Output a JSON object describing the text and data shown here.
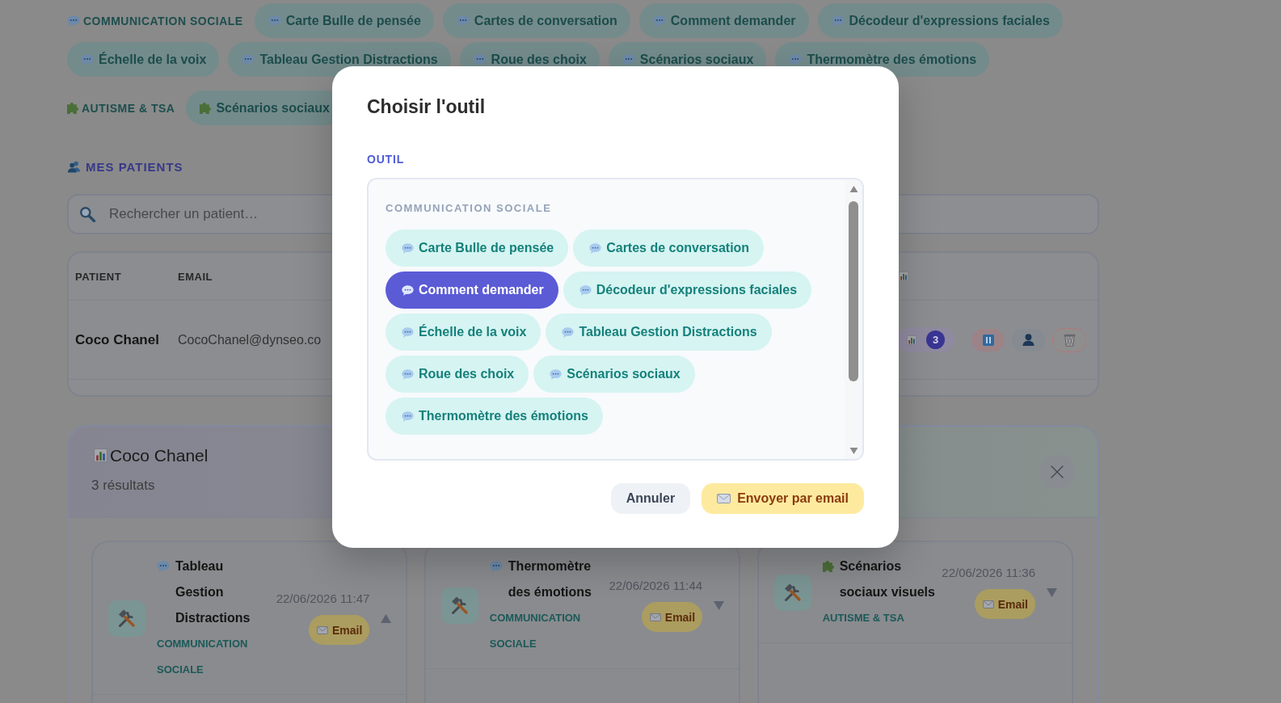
{
  "tool_groups": [
    {
      "label": "COMMUNICATION SOCIALE",
      "kind": "speech",
      "tools": [
        "Carte Bulle de pensée",
        "Cartes de conversation",
        "Comment demander",
        "Décodeur d'expressions faciales",
        "Échelle de la voix",
        "Tableau Gestion Distractions",
        "Roue des choix",
        "Scénarios sociaux",
        "Thermomètre des émotions"
      ]
    },
    {
      "label": "AUTISME & TSA",
      "kind": "puzzle",
      "tools": [
        "Scénarios sociaux"
      ]
    }
  ],
  "patients": {
    "title": "MES PATIENTS",
    "search": {
      "placeholder": "Rechercher un patient…"
    },
    "table": {
      "columns": [
        "PATIENT",
        "EMAIL"
      ],
      "rows": [
        {
          "name": "Coco Chanel",
          "email": "CocoChanel@dynseo.co",
          "results_count": "3"
        }
      ]
    }
  },
  "results_panel": {
    "title": "Coco Chanel",
    "count": "3 résultats",
    "results": [
      {
        "kind": "speech",
        "title": "Tableau Gestion Distractions",
        "category": "COMMUNICATION SOCIALE",
        "date": "22/06/2026 11:47",
        "action": "Email",
        "expanded": true
      },
      {
        "kind": "speech",
        "title": "Thermomètre des émotions",
        "category": "COMMUNICATION SOCIALE",
        "date": "22/06/2026 11:44",
        "action": "Email",
        "expanded": false
      },
      {
        "kind": "puzzle",
        "title": "Scénarios sociaux visuels",
        "category": "AUTISME & TSA",
        "date": "22/06/2026 11:36",
        "action": "Email",
        "expanded": false
      }
    ]
  },
  "dialog": {
    "title": "Choisir l'outil",
    "field_label": "OUTIL",
    "groups": [
      {
        "label": "COMMUNICATION SOCIALE",
        "kind": "speech",
        "options": [
          {
            "label": "Carte Bulle de pensée",
            "selected": false
          },
          {
            "label": "Cartes de conversation",
            "selected": false
          },
          {
            "label": "Comment demander",
            "selected": true
          },
          {
            "label": "Décodeur d'expressions faciales",
            "selected": false
          },
          {
            "label": "Échelle de la voix",
            "selected": false
          },
          {
            "label": "Tableau Gestion Distractions",
            "selected": false
          },
          {
            "label": "Roue des choix",
            "selected": false
          },
          {
            "label": "Scénarios sociaux",
            "selected": false
          },
          {
            "label": "Thermomètre des émotions",
            "selected": false
          }
        ]
      }
    ],
    "buttons": [
      {
        "label": "Annuler",
        "kind": "secondary"
      },
      {
        "label": "Envoyer par email",
        "kind": "primary"
      }
    ]
  }
}
